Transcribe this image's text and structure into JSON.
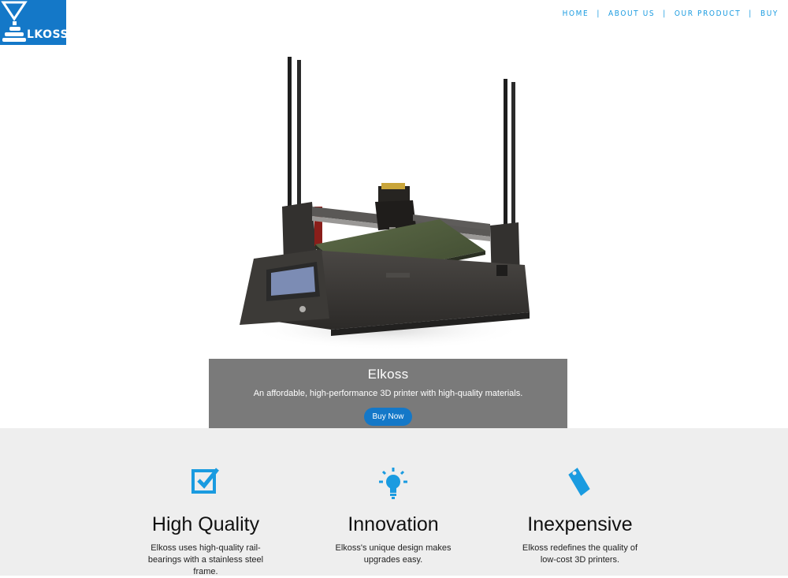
{
  "brand": {
    "logo_text": "LKOSS"
  },
  "nav": {
    "items": [
      {
        "label": "HOME"
      },
      {
        "label": "ABOUT US"
      },
      {
        "label": "OUR PRODUCT"
      },
      {
        "label": "BUY"
      }
    ],
    "separator": "|"
  },
  "hero": {
    "title": "Elkoss",
    "subtitle": "An affordable, high-performance 3D printer with high-quality materials.",
    "button_label": "Buy Now"
  },
  "features": [
    {
      "icon": "checkbox-icon",
      "title": "High Quality",
      "text": "Elkoss uses high-quality rail-bearings with a stainless steel frame."
    },
    {
      "icon": "lightbulb-icon",
      "title": "Innovation",
      "text": "Elkoss's unique design makes upgrades easy."
    },
    {
      "icon": "price-tag-icon",
      "title": "Inexpensive",
      "text": "Elkoss redefines the quality of low-cost 3D printers."
    }
  ],
  "colors": {
    "accent": "#1478c8",
    "nav_text": "#1a9be0",
    "caption_bg": "#7a7a7a",
    "features_bg": "#eeeeee"
  }
}
